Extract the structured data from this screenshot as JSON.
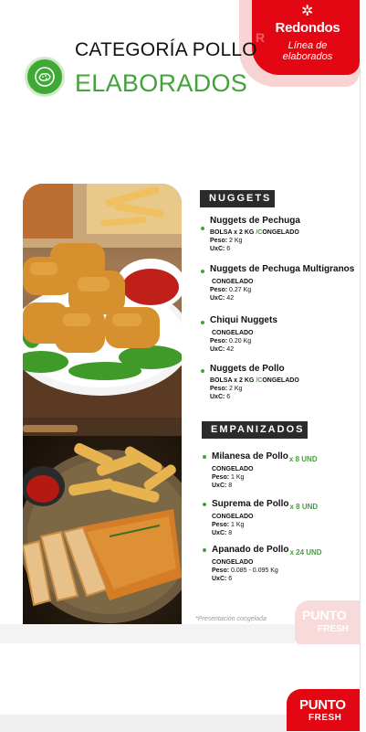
{
  "brand": {
    "name": "Redondos",
    "subtitle_line1": "Línea de",
    "subtitle_line2": "elaborados",
    "logo_mark": "star-icon",
    "primary_color": "#e30613",
    "accent_green": "#43a23a"
  },
  "header": {
    "title_line1": "CATEGORÍA POLLO",
    "title_line2": "ELABORADOS",
    "icon": "nuggets-icon"
  },
  "sections": {
    "nuggets": {
      "label": "NUGGETS",
      "items": [
        {
          "name": "Nuggets de Pechuga",
          "pack_prefix": "BOLSA x 2 KG ",
          "pack_slash": "/C",
          "pack_suffix": "ONGELADO",
          "peso_label": "Peso:",
          "peso": "2 Kg",
          "uxc_label": "UxC:",
          "uxc": "6"
        },
        {
          "name": "Nuggets de Pechuga Multigranos",
          "pack": "CONGELADO",
          "peso_label": "Peso:",
          "peso": "0.27  Kg",
          "uxc_label": "UxC:",
          "uxc": "42"
        },
        {
          "name": "Chiqui Nuggets",
          "pack": "CONGELADO",
          "peso_label": "Peso:",
          "peso": "0.20  Kg",
          "uxc_label": "UxC:",
          "uxc": "42"
        },
        {
          "name": "Nuggets de Pollo",
          "pack_prefix": "BOLSA x 2 KG ",
          "pack_slash": "/C",
          "pack_suffix": "ONGELADO",
          "peso_label": "Peso:",
          "peso": "2 Kg",
          "uxc_label": "UxC:",
          "uxc": "6"
        }
      ]
    },
    "empanizados": {
      "label": "EMPANIZADOS",
      "items": [
        {
          "name": "Milanesa de Pollo",
          "qty": "x 8 UND",
          "pack": "CONGELADO",
          "peso_label": "Peso:",
          "peso": "1 Kg",
          "uxc_label": "UxC:",
          "uxc": "8"
        },
        {
          "name": "Suprema de Pollo",
          "qty": "x 8 UND",
          "pack": "CONGELADO",
          "peso_label": "Peso:",
          "peso": "1 Kg",
          "uxc_label": "UxC:",
          "uxc": "8"
        },
        {
          "name": "Apanado de Pollo",
          "qty": "x 24 UND",
          "pack": "CONGELADO",
          "peso_label": "Peso:",
          "peso": "0.085 - 0.095 Kg",
          "uxc_label": "UxC:",
          "uxc": "6"
        }
      ]
    }
  },
  "note": "*Presentación congelada",
  "footer": {
    "logo_line1": "PUNTO",
    "logo_line2": "FRESH"
  }
}
